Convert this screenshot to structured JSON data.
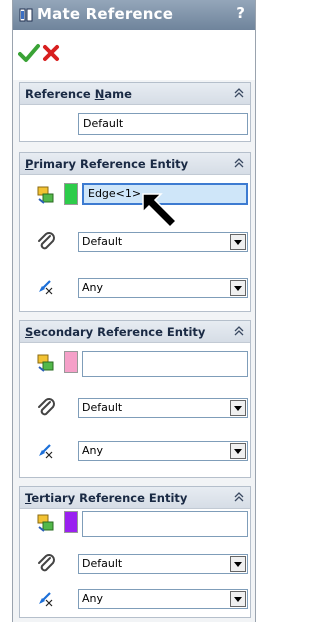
{
  "window": {
    "title": "Mate Reference",
    "help_label": "?"
  },
  "reference_name": {
    "header": {
      "before": "Reference ",
      "underlined": "N",
      "after": "ame"
    },
    "value": "Default"
  },
  "groups": [
    {
      "id": "primary",
      "header": {
        "before": "",
        "underlined": "P",
        "after": "rimary Reference Entity"
      },
      "swatch_color": "#2dcc4a",
      "entity_value": "Edge<1>",
      "type_value": "Default",
      "alignment_value": "Any"
    },
    {
      "id": "secondary",
      "header": {
        "before": "",
        "underlined": "S",
        "after": "econdary Reference Entity"
      },
      "swatch_color": "#f5a0c8",
      "entity_value": "",
      "type_value": "Default",
      "alignment_value": "Any"
    },
    {
      "id": "tertiary",
      "header": {
        "before": "",
        "underlined": "T",
        "after": "ertiary Reference Entity"
      },
      "swatch_color": "#9a20f0",
      "entity_value": "",
      "type_value": "Default",
      "alignment_value": "Any"
    }
  ],
  "icons": {
    "ok": "green-check-icon",
    "cancel": "red-x-icon",
    "collapse": "double-chevron-up-icon",
    "entity": "reference-entity-icon",
    "type": "paperclip-icon",
    "alignment": "alignment-arrow-icon",
    "cursor": "mouse-pointer-icon"
  },
  "colors": {
    "title_bar": "#7f93ab",
    "active_field": "#cfe6f9",
    "ok": "#3aa336",
    "cancel": "#d81f1f"
  }
}
